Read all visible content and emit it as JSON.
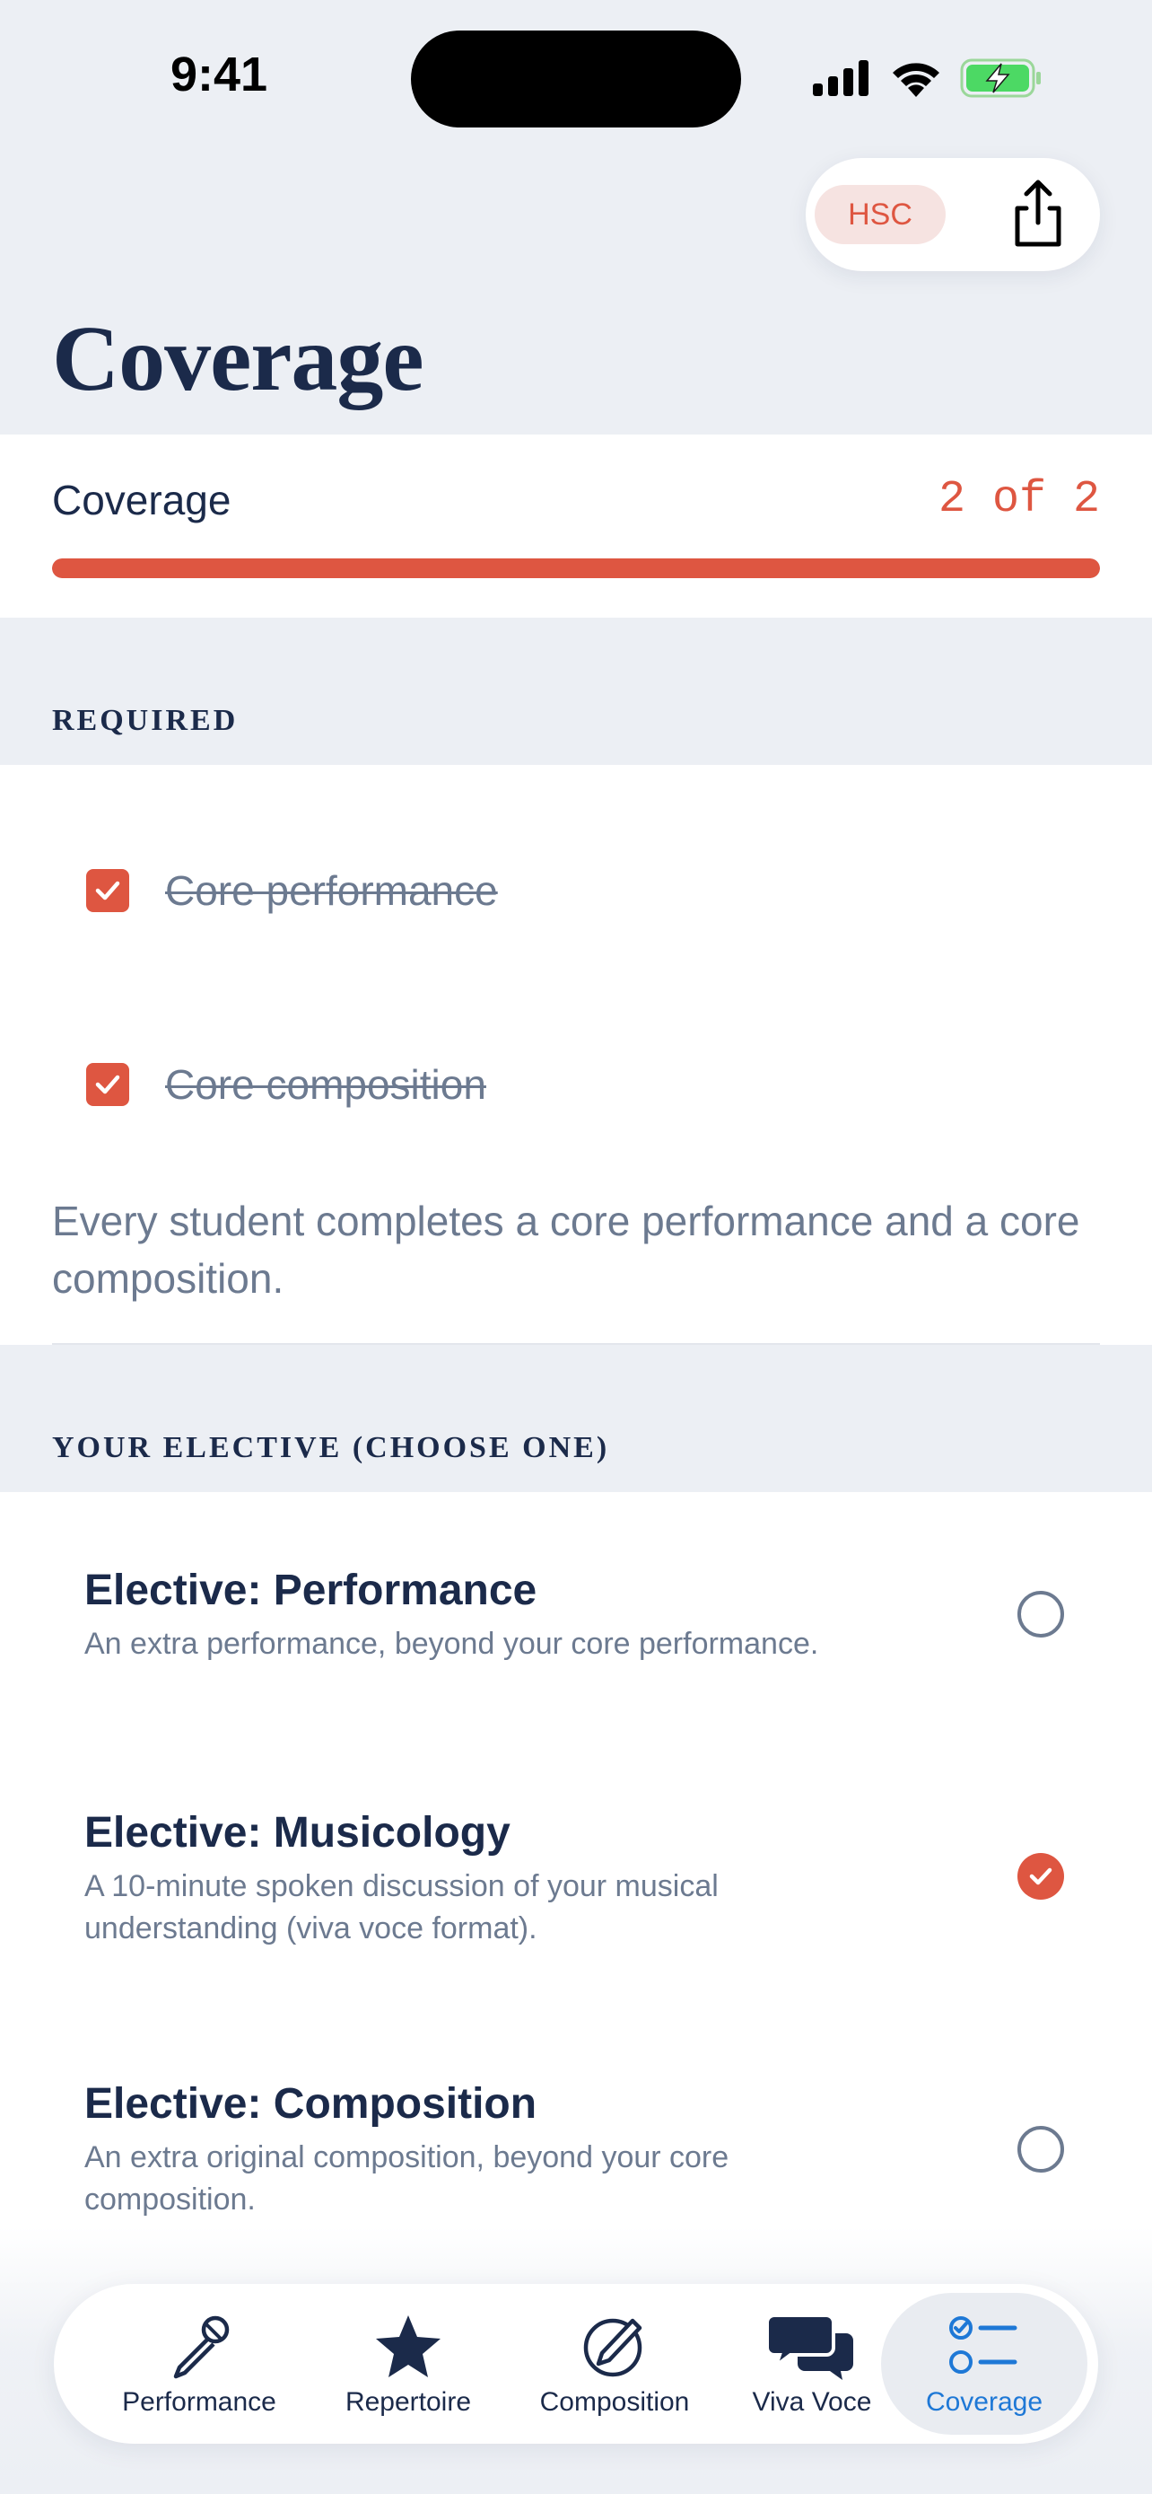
{
  "status_bar": {
    "time": "9:41"
  },
  "header": {
    "badge": "HSC",
    "title": "Coverage"
  },
  "coverage": {
    "label": "Coverage",
    "count": "2 of 2",
    "progress": 1.0
  },
  "required": {
    "header": "REQUIRED",
    "items": [
      {
        "label": "Core performance",
        "checked": true
      },
      {
        "label": "Core composition",
        "checked": true
      }
    ],
    "note": "Every student completes a core performance and a core composition."
  },
  "elective": {
    "header": "YOUR ELECTIVE (CHOOSE ONE)",
    "items": [
      {
        "title": "Elective: Performance",
        "description": "An extra performance, beyond your core performance.",
        "selected": false
      },
      {
        "title": "Elective: Musicology",
        "description": "A 10-minute spoken discussion of your musical understanding (viva voce format).",
        "selected": true
      },
      {
        "title": "Elective: Composition",
        "description": "An extra original composition, beyond your core composition.",
        "selected": false
      }
    ]
  },
  "tabs": [
    {
      "label": "Performance",
      "icon": "microphone-icon"
    },
    {
      "label": "Repertoire",
      "icon": "star-icon"
    },
    {
      "label": "Composition",
      "icon": "pencil-circle-icon"
    },
    {
      "label": "Viva Voce",
      "icon": "speech-bubbles-icon"
    },
    {
      "label": "Coverage",
      "icon": "checklist-icon",
      "active": true
    }
  ],
  "colors": {
    "accent": "#DE5641",
    "navy": "#1B2A4A",
    "muted": "#6C7A90",
    "active_tab": "#1E78D6",
    "background": "#ECEFF4"
  }
}
